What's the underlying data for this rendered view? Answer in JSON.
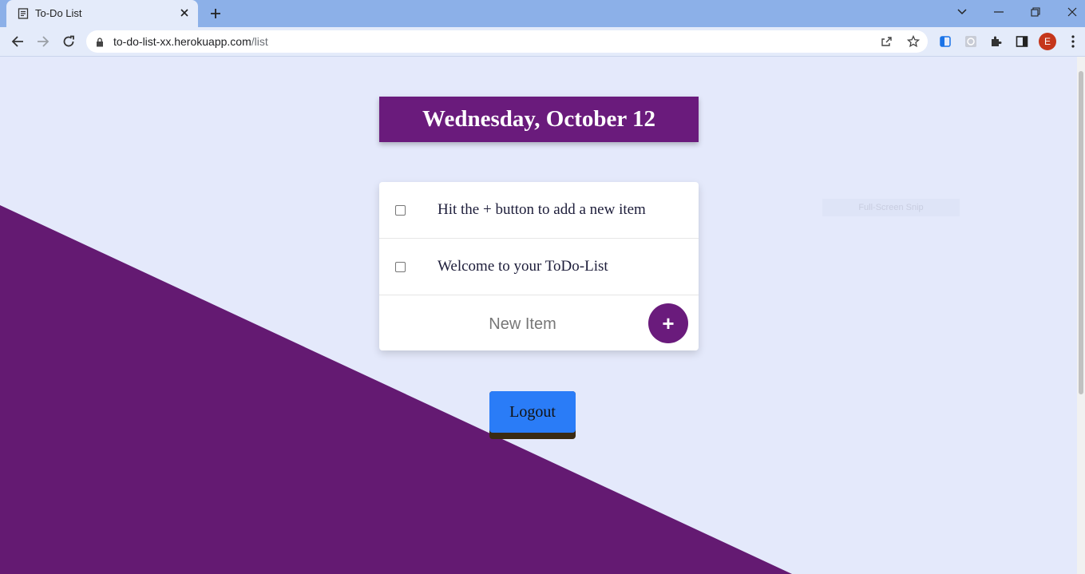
{
  "browser": {
    "tab_title": "To-Do List",
    "url_host": "to-do-list-xx.herokuapp.com",
    "url_path": "/list",
    "profile_initial": "E"
  },
  "page": {
    "date_heading": "Wednesday, October 12",
    "items": [
      {
        "label": "Hit the + button to add a new item",
        "checked": false
      },
      {
        "label": "Welcome to your ToDo-List",
        "checked": false
      }
    ],
    "new_item_placeholder": "New Item",
    "add_button_label": "+",
    "logout_label": "Logout",
    "snip_overlay": "Full-Screen Snip"
  },
  "colors": {
    "accent_purple": "#6a1b7c",
    "background": "#e4e9fb",
    "logout_blue": "#2a7cf7"
  }
}
